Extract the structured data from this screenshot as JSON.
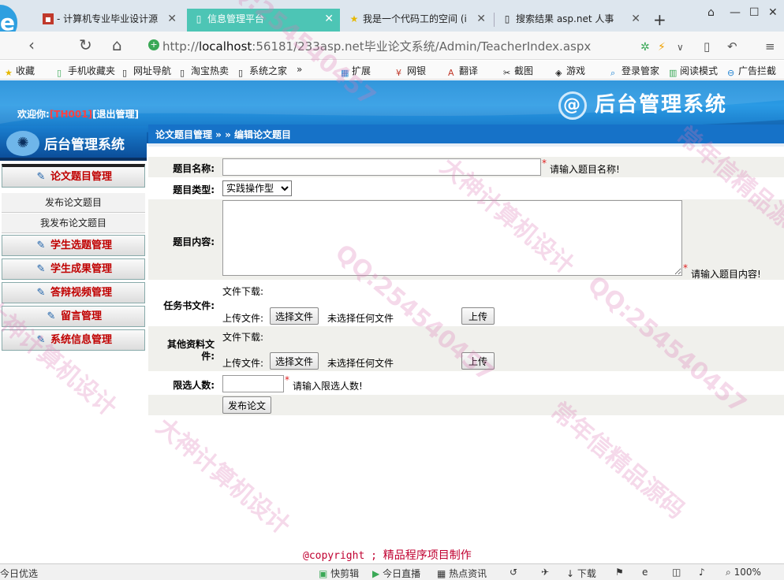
{
  "browser": {
    "tabs": [
      {
        "title": "- 计算机专业毕业设计源",
        "icon": "red-square-icon",
        "active": false
      },
      {
        "title": "信息管理平台",
        "icon": "page-icon",
        "active": true
      },
      {
        "title": "我是一个代码工的空间 (i",
        "icon": "star-icon",
        "active": false
      },
      {
        "title": "搜索结果 asp.net 人事",
        "icon": "page-icon",
        "active": false
      }
    ],
    "url_prefix": "http://",
    "url_host": "localhost",
    "url_rest": ":56181/233asp.net毕业论文系统/Admin/TeacherIndex.aspx",
    "bookmarks": [
      "收藏",
      "手机收藏夹",
      "网址导航",
      "淘宝热卖",
      "系统之家",
      "»",
      "扩展",
      "网银",
      "翻译",
      "截图",
      "游戏",
      "登录管家",
      "阅读模式",
      "广告拦截"
    ]
  },
  "header": {
    "welcome_prefix": "欢迎你:",
    "user_id": "[TH001]",
    "logout_label": "[退出管理]",
    "system_title": "后台管理系统",
    "breadcrumb": "论文题目管理 » » 编辑论文题目"
  },
  "sidebar": {
    "logo_title": "后台管理系统",
    "menus": [
      {
        "label": "论文题目管理",
        "subs": [
          "发布论文题目",
          "我发布论文题目"
        ]
      },
      {
        "label": "学生选题管理",
        "subs": []
      },
      {
        "label": "学生成果管理",
        "subs": []
      },
      {
        "label": "答辩视频管理",
        "subs": []
      },
      {
        "label": "留言管理",
        "subs": []
      },
      {
        "label": "系统信息管理",
        "subs": []
      }
    ]
  },
  "form": {
    "title_label": "题目名称:",
    "title_value": "",
    "title_hint": "请输入题目名称!",
    "type_label": "题目类型:",
    "type_value": "实践操作型",
    "content_label": "题目内容:",
    "content_hint": "请输入题目内容!",
    "task_label": "任务书文件:",
    "file_download_label": "文件下载:",
    "file_upload_label": "上传文件:",
    "choose_file_label": "选择文件",
    "no_file_label": "未选择任何文件",
    "upload_label": "上传",
    "other_label_1": "其他资料文",
    "other_label_2": "件:",
    "limit_label": "限选人数:",
    "limit_value": "",
    "limit_hint": "请输入限选人数!",
    "required_mark": "*",
    "submit_label": "发布论文"
  },
  "footer": {
    "copyright_prefix": "@copyright ;",
    "copyright_text": "精品程序项目制作"
  },
  "statusbar": {
    "left": "今日优选",
    "items": [
      "快剪辑",
      "今日直播",
      "热点资讯",
      "下载",
      "100%"
    ]
  },
  "watermarks": [
    "QQ:254540457",
    "大神计算机设计",
    "常年信精品源码",
    "QQ:254540457",
    "大神计算机设计",
    "常年信精品源码",
    "QQ:254540457",
    "大神计算机设计"
  ]
}
